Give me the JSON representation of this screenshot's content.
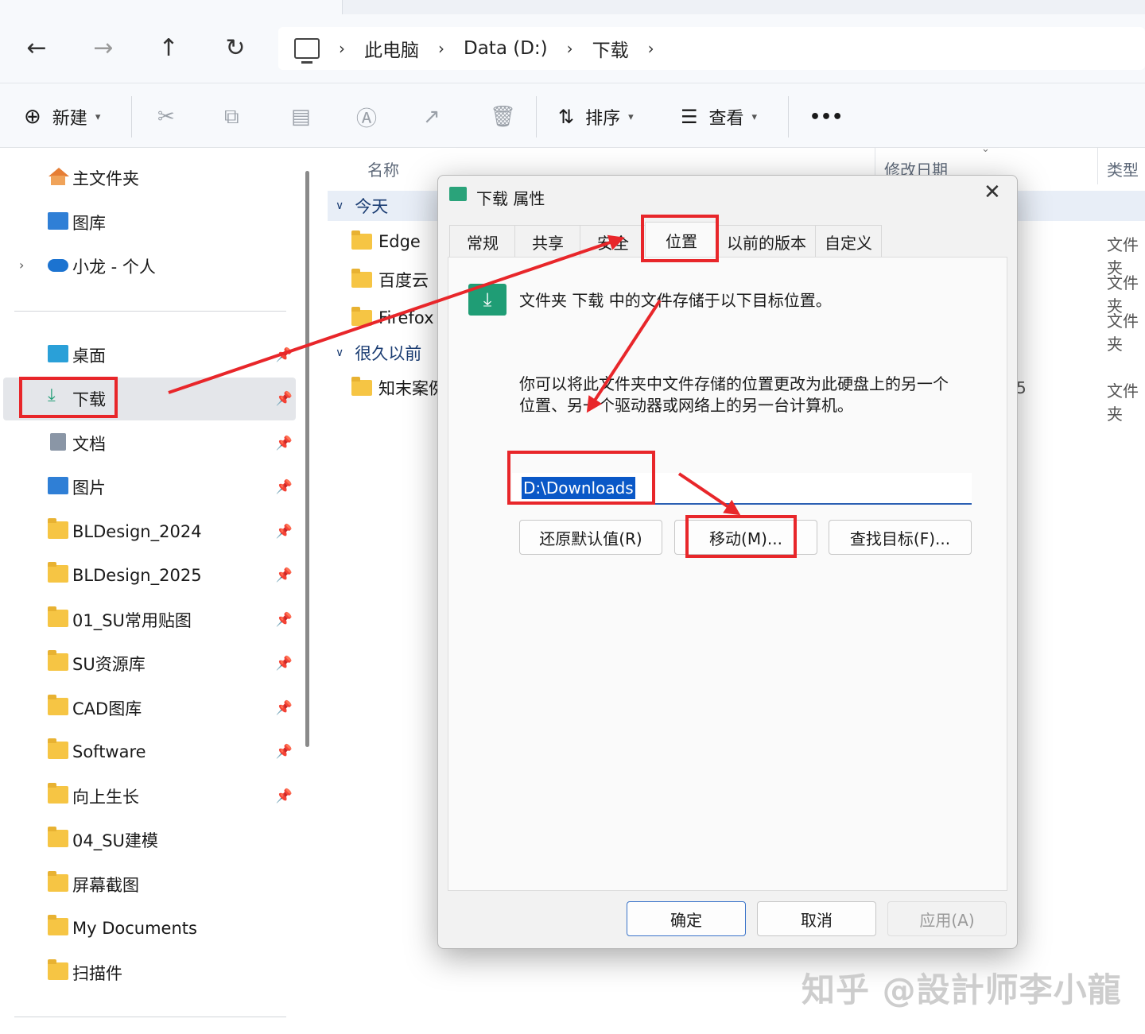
{
  "nav": {
    "back": "←",
    "forward": "→",
    "up": "↑",
    "refresh": "↻",
    "breadcrumb": [
      "此电脑",
      "Data (D:)",
      "下载"
    ],
    "sep": "›"
  },
  "toolbar": {
    "new": "新建",
    "sort": "排序",
    "view": "查看",
    "more": "•••"
  },
  "sidebar": {
    "top": [
      {
        "label": "主文件夹"
      },
      {
        "label": "图库"
      },
      {
        "label": "小龙 - 个人"
      }
    ],
    "pinned": [
      {
        "label": "桌面"
      },
      {
        "label": "下载"
      },
      {
        "label": "文档"
      },
      {
        "label": "图片"
      },
      {
        "label": "BLDesign_2024"
      },
      {
        "label": "BLDesign_2025"
      },
      {
        "label": "01_SU常用贴图"
      },
      {
        "label": "SU资源库"
      },
      {
        "label": "CAD图库"
      },
      {
        "label": "Software"
      },
      {
        "label": "向上生长"
      },
      {
        "label": "04_SU建模"
      },
      {
        "label": "屏幕截图"
      },
      {
        "label": "My Documents"
      },
      {
        "label": "扫描件"
      }
    ]
  },
  "filelist": {
    "col_name": "名称",
    "col_date": "修改日期",
    "col_type": "类型",
    "group_today": "今天",
    "group_old": "很久以前",
    "rows_today": [
      "Edge",
      "百度云",
      "Firefox"
    ],
    "rows_old": [
      "知末案例"
    ],
    "type_value": "文件夹",
    "partial_date": "5"
  },
  "dialog": {
    "title": "下载 属性",
    "close": "✕",
    "tabs": [
      "常规",
      "共享",
      "安全",
      "位置",
      "以前的版本",
      "自定义"
    ],
    "desc1": "文件夹 下载 中的文件存储于以下目标位置。",
    "desc2_line1": "你可以将此文件夹中文件存储的位置更改为此硬盘上的另一个",
    "desc2_line2": "位置、另一个驱动器或网络上的另一台计算机。",
    "path": "D:\\Downloads",
    "btn_restore": "还原默认值(R)",
    "btn_move": "移动(M)...",
    "btn_find": "查找目标(F)...",
    "btn_ok": "确定",
    "btn_cancel": "取消",
    "btn_apply": "应用(A)"
  },
  "watermark": "知乎 @設計师李小龍",
  "colors": {
    "accent": "#0a58c7",
    "annotation": "#e8262a",
    "folder": "#f6c544"
  }
}
